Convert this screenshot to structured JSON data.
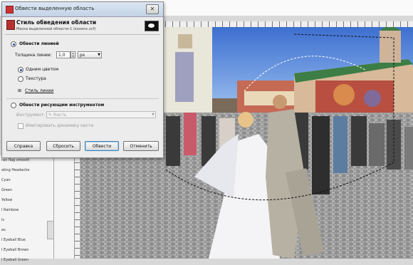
{
  "dialog": {
    "title": "Обвести выделенную область",
    "close_label": "✕",
    "header_title": "Стиль обведения области",
    "header_subtitle": "Маска выделенной области-1 (конинс.xcf)",
    "stroke_line_label": "Обвести линией",
    "line_width_label": "Толщина линии:",
    "line_width_value": "1,0",
    "unit_value": "px",
    "solid_color_label": "Одним цветом",
    "texture_label": "Текстура",
    "line_style_label": "Стиль линии",
    "stroke_tool_label": "Обвести рисующим инструментом",
    "tool_label": "Инструмент:",
    "tool_value": "Кисть",
    "emulate_dynamics_label": "Имитировать динамику кисти",
    "buttons": {
      "help": "Справка",
      "reset": "Сбросить",
      "stroke": "Обвести",
      "cancel": "Отменить"
    }
  },
  "brushes_panel": {
    "items": [
      "ran flag smooth",
      "ating Headache",
      "Cyan",
      "Green",
      "Yellow",
      "l Rainbow",
      "ls",
      "es",
      "l Eyeball Blue",
      "l Eyeball Brown",
      "l Eyeball Green"
    ]
  }
}
